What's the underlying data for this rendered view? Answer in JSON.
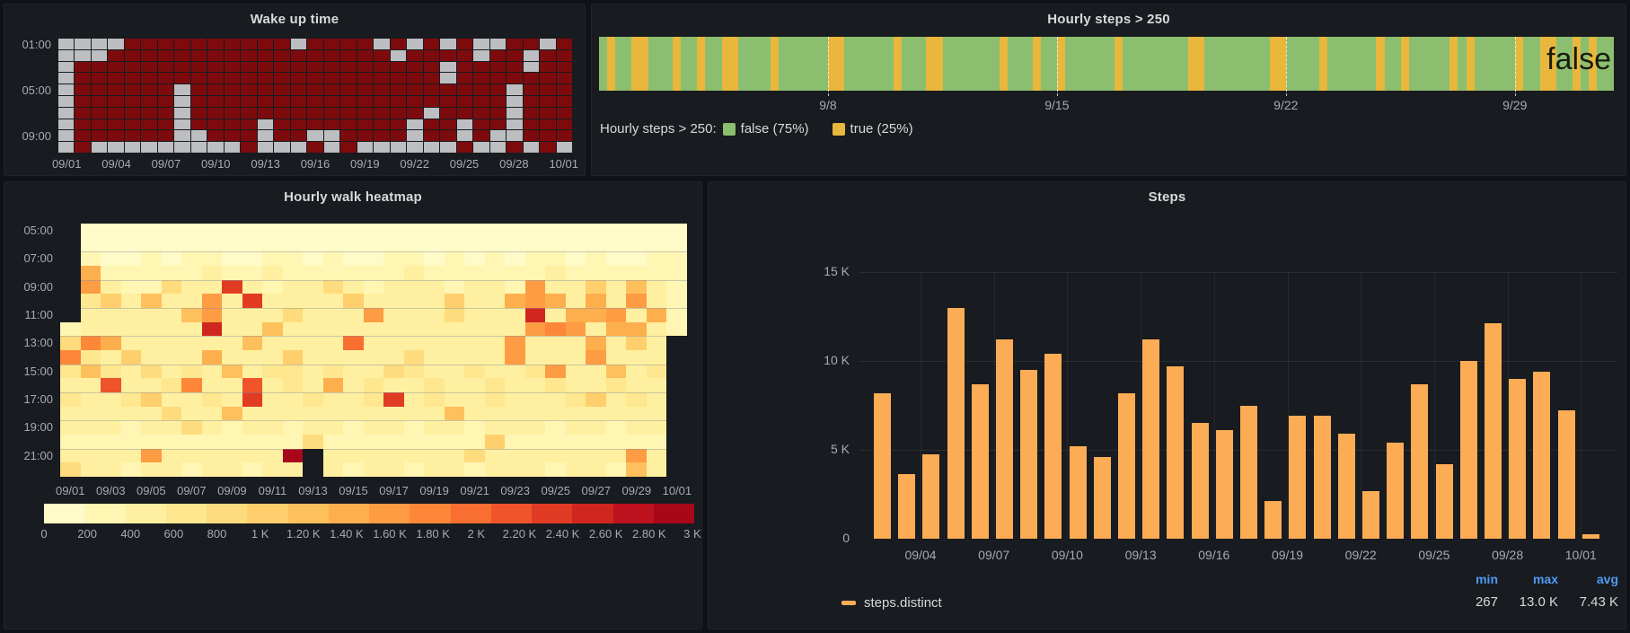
{
  "dashboard": {
    "background": "#111217",
    "panel_background": "#181b1f"
  },
  "chart_data": [
    {
      "id": "wake-up-time",
      "type": "heatmap",
      "title": "Wake up time",
      "y_tick_labels": [
        "01:00",
        "05:00",
        "09:00"
      ],
      "x_tick_labels": [
        "09/01",
        "09/04",
        "09/07",
        "09/10",
        "09/13",
        "09/16",
        "09/19",
        "09/22",
        "09/25",
        "09/28",
        "10/01"
      ],
      "cell_colors": {
        "asleep": "#7d0b0d",
        "no_data": "#bdbec1"
      },
      "rows": [
        "ggggrrrrrrrrrrgrrrrgrgrgrggrrgr",
        "gggrrrrrrrrrrrrrrrrrgrrrrgrrgrr",
        "grrrrrrrrrrrrrrrrrrrrrrgrrrrgrr",
        "grrrrrrrrrrrrrrrrrrrrrrgrrrrrrr",
        "grrrrrrgrrrrrrrrrrrrrrrrrrrgrrr",
        "grrrrrrgrrrrrrrrrrrrrrrrrrrgrrr",
        "grrrrrrgrrrrrrrrrrrrrrgrrrrgrrr",
        "grrrrrrgrrrrgrrrrrrrrgrrgrrgrrr",
        "grrrrrrggrrrgrrggrrrrgrrgrggrrr",
        "grgggggggggrgggrgrggggggrggrgrg"
      ]
    },
    {
      "id": "hourly-steps-gt-250",
      "type": "state-timeline",
      "title": "Hourly steps > 250",
      "slices": [
        "gyggyygggy",
        "ggyggyyggg",
        "gyggggggyy",
        "ggggggyggg",
        "yygggggggy",
        "gggyggyggg",
        "gggygggggg",
        "ggyygggggg",
        "ggyyggggyg",
        "gggggyggyg",
        "ggggygyggg",
        "ggyggyyggy",
        "gygg"
      ],
      "slice_colors": {
        "g": "#8cbe70",
        "y": "#e8b73c"
      },
      "x_tick_labels": [
        "9/8",
        "9/15",
        "9/22",
        "9/29"
      ],
      "current_value_label": "false",
      "legend_title": "Hourly steps > 250:",
      "legend": [
        {
          "label": "false (75%)",
          "color": "#8cbe70"
        },
        {
          "label": "true (25%)",
          "color": "#e8b73c"
        }
      ]
    },
    {
      "id": "hourly-walk-heatmap",
      "type": "heatmap",
      "title": "Hourly walk heatmap",
      "y_tick_labels": [
        "05:00",
        "07:00",
        "09:00",
        "11:00",
        "13:00",
        "15:00",
        "17:00",
        "19:00",
        "21:00"
      ],
      "x_tick_labels": [
        "09/01",
        "09/03",
        "09/05",
        "09/07",
        "09/09",
        "09/11",
        "09/13",
        "09/15",
        "09/17",
        "09/19",
        "09/21",
        "09/23",
        "09/25",
        "09/27",
        "09/29",
        "10/01"
      ],
      "value_range": [
        0,
        3000
      ],
      "scale": {
        "colors": [
          "#fffbc9",
          "#fff6b3",
          "#fef0a0",
          "#fee78e",
          "#fedc7d",
          "#fecf6c",
          "#fec05c",
          "#feaf4d",
          "#fd9c42",
          "#fd8739",
          "#f96e31",
          "#ef542a",
          "#e23b24",
          "#d12620",
          "#bd121d",
          "#a8071a"
        ],
        "tick_labels": [
          "0",
          "200",
          "400",
          "600",
          "800",
          "1 K",
          "1.20 K",
          "1.40 K",
          "1.60 K",
          "1.80 K",
          "2 K",
          "2.20 K",
          "2.40 K",
          "2.60 K",
          "2.80 K",
          "3 K"
        ]
      },
      "values": [
        [
          null,
          120,
          100,
          90,
          110,
          100,
          95,
          120,
          110,
          100,
          90,
          140,
          100,
          110,
          95,
          100,
          120,
          90,
          100,
          110,
          95,
          100,
          90,
          120,
          110,
          100,
          95,
          110,
          100,
          90,
          130
        ],
        [
          null,
          150,
          130,
          120,
          140,
          110,
          130,
          150,
          120,
          140,
          110,
          160,
          130,
          120,
          140,
          110,
          150,
          130,
          120,
          110,
          140,
          130,
          120,
          150,
          140,
          110,
          130,
          120,
          140,
          110,
          150
        ],
        [
          null,
          220,
          180,
          160,
          200,
          170,
          190,
          240,
          180,
          160,
          300,
          200,
          170,
          190,
          160,
          180,
          200,
          240,
          170,
          190,
          160,
          200,
          180,
          220,
          190,
          170,
          200,
          160,
          180,
          190,
          210
        ],
        [
          null,
          1350,
          250,
          200,
          350,
          280,
          240,
          420,
          300,
          260,
          380,
          240,
          280,
          320,
          260,
          300,
          280,
          420,
          260,
          240,
          300,
          280,
          320,
          260,
          440,
          280,
          250,
          300,
          260,
          280,
          320
        ],
        [
          null,
          1500,
          400,
          300,
          350,
          900,
          420,
          380,
          2350,
          400,
          360,
          420,
          380,
          800,
          420,
          360,
          400,
          440,
          380,
          360,
          420,
          400,
          360,
          1500,
          420,
          380,
          1100,
          400,
          1250,
          420,
          300
        ],
        [
          null,
          600,
          1000,
          420,
          1150,
          500,
          460,
          1550,
          500,
          2400,
          460,
          500,
          520,
          480,
          1050,
          500,
          460,
          520,
          480,
          1000,
          500,
          460,
          1400,
          1500,
          1450,
          520,
          1350,
          480,
          1500,
          460,
          250
        ],
        [
          null,
          500,
          450,
          480,
          520,
          460,
          1250,
          1500,
          480,
          520,
          460,
          800,
          500,
          480,
          520,
          1550,
          480,
          500,
          460,
          820,
          500,
          480,
          460,
          2600,
          520,
          1400,
          1450,
          1550,
          480,
          1400,
          300
        ],
        [
          300,
          550,
          480,
          500,
          460,
          520,
          480,
          2450,
          500,
          460,
          1300,
          480,
          520,
          500,
          460,
          480,
          520,
          460,
          500,
          480,
          520,
          460,
          480,
          1650,
          1750,
          1500,
          520,
          1450,
          1350,
          480,
          250
        ],
        [
          900,
          1800,
          1450,
          520,
          480,
          500,
          520,
          480,
          500,
          1200,
          480,
          520,
          500,
          480,
          2050,
          500,
          480,
          520,
          460,
          500,
          480,
          520,
          1500,
          480,
          520,
          500,
          1450,
          520,
          1050,
          500,
          null
        ],
        [
          1700,
          600,
          550,
          1100,
          520,
          560,
          540,
          1400,
          560,
          520,
          540,
          1100,
          560,
          540,
          520,
          560,
          540,
          880,
          560,
          540,
          520,
          560,
          1500,
          540,
          560,
          520,
          1600,
          540,
          560,
          520,
          null
        ],
        [
          700,
          1300,
          580,
          540,
          820,
          560,
          580,
          540,
          1300,
          560,
          580,
          640,
          560,
          580,
          540,
          560,
          820,
          580,
          540,
          560,
          580,
          540,
          560,
          580,
          1600,
          560,
          540,
          1200,
          560,
          580,
          null
        ],
        [
          500,
          560,
          2200,
          540,
          560,
          580,
          1800,
          560,
          540,
          2200,
          560,
          580,
          540,
          1450,
          560,
          580,
          540,
          560,
          580,
          540,
          560,
          580,
          560,
          540,
          580,
          560,
          540,
          580,
          560,
          540,
          null
        ],
        [
          600,
          540,
          560,
          580,
          1000,
          560,
          540,
          580,
          560,
          2400,
          540,
          560,
          580,
          540,
          560,
          580,
          2300,
          540,
          580,
          560,
          540,
          580,
          560,
          540,
          560,
          580,
          1100,
          560,
          580,
          540,
          null
        ],
        [
          500,
          480,
          500,
          460,
          480,
          900,
          460,
          480,
          1250,
          460,
          480,
          500,
          460,
          480,
          500,
          460,
          480,
          500,
          460,
          1150,
          480,
          460,
          500,
          480,
          460,
          500,
          480,
          460,
          500,
          480,
          null
        ],
        [
          400,
          380,
          400,
          360,
          380,
          400,
          900,
          380,
          360,
          400,
          380,
          360,
          400,
          380,
          360,
          400,
          380,
          360,
          400,
          380,
          360,
          400,
          380,
          400,
          360,
          380,
          400,
          360,
          380,
          400,
          null
        ],
        [
          350,
          330,
          350,
          310,
          330,
          350,
          310,
          330,
          350,
          310,
          330,
          350,
          810,
          330,
          310,
          350,
          330,
          310,
          330,
          350,
          310,
          1000,
          330,
          350,
          310,
          330,
          350,
          310,
          330,
          350,
          null
        ],
        [
          450,
          430,
          450,
          410,
          1500,
          450,
          410,
          430,
          450,
          410,
          430,
          3000,
          null,
          430,
          410,
          450,
          430,
          410,
          430,
          450,
          880,
          430,
          410,
          430,
          450,
          410,
          430,
          410,
          1550,
          430,
          null
        ],
        [
          800,
          380,
          400,
          360,
          380,
          400,
          360,
          380,
          400,
          360,
          380,
          400,
          null,
          380,
          360,
          400,
          380,
          360,
          380,
          400,
          360,
          380,
          400,
          380,
          360,
          380,
          400,
          360,
          1200,
          380,
          null
        ]
      ]
    },
    {
      "id": "steps",
      "type": "bar",
      "title": "Steps",
      "values": [
        8200,
        3650,
        4750,
        13000,
        8700,
        11200,
        9500,
        10400,
        5200,
        4600,
        8200,
        11200,
        9700,
        6500,
        6100,
        7500,
        2100,
        6900,
        6900,
        5900,
        2700,
        5400,
        8700,
        4200,
        10000,
        12100,
        9000,
        9400,
        7200,
        267
      ],
      "ylim": [
        0,
        15000
      ],
      "y_tick_labels": [
        "0",
        "5 K",
        "10 K",
        "15 K"
      ],
      "x_tick_labels": [
        "09/04",
        "09/07",
        "09/10",
        "09/13",
        "09/16",
        "09/19",
        "09/22",
        "09/25",
        "09/28",
        "10/01"
      ],
      "series": [
        {
          "name": "steps.distinct",
          "color": "#fcac54"
        }
      ],
      "stats": {
        "header_color": "#4f9bf5",
        "headers": [
          "min",
          "max",
          "avg"
        ],
        "values": [
          "267",
          "13.0 K",
          "7.43 K"
        ]
      }
    }
  ]
}
